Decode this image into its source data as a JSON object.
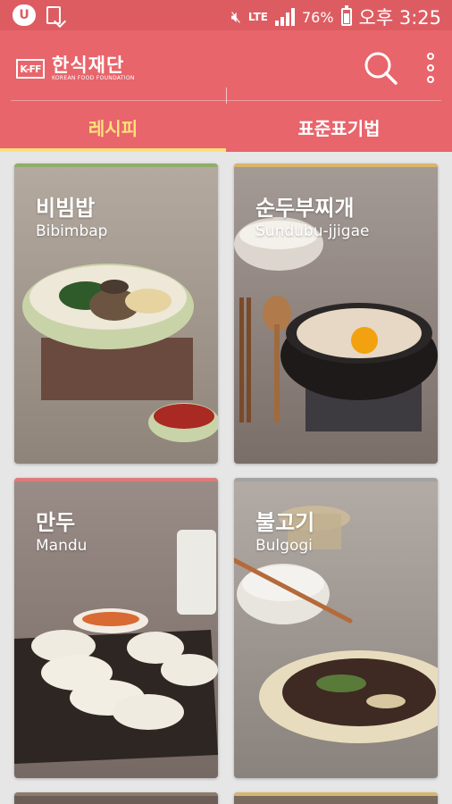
{
  "status_bar": {
    "battery_percent": "76%",
    "time": "오후 3:25",
    "network": "LTE",
    "icons": [
      "u-plus-icon",
      "download-icon",
      "mute-icon",
      "signal-icon",
      "battery-icon"
    ]
  },
  "header": {
    "logo_mark": "K-FF",
    "logo_korean": "한식재단",
    "logo_english": "KOREAN FOOD FOUNDATION",
    "icons": [
      "search-icon",
      "more-vert-icon"
    ]
  },
  "tabs": [
    {
      "label": "레시피",
      "active": true
    },
    {
      "label": "표준표기법",
      "active": false
    }
  ],
  "colors": {
    "brand": "#e8656b",
    "status_bar": "#dd5c62",
    "active_tab": "#ffe07a",
    "background": "#e6e6e6"
  },
  "recipes": [
    {
      "korean": "비빔밥",
      "english": "Bibimbap",
      "stripe": "#8fae6a"
    },
    {
      "korean": "순두부찌개",
      "english": "Sundubu-jjigae",
      "stripe": "#d8b66a"
    },
    {
      "korean": "만두",
      "english": "Mandu",
      "stripe": "#e07a7a"
    },
    {
      "korean": "불고기",
      "english": "Bulgogi",
      "stripe": "#a3a3a3"
    },
    {
      "korean": "",
      "english": "",
      "stripe": "#8d7b6a"
    },
    {
      "korean": "",
      "english": "",
      "stripe": "#d8b66a"
    }
  ]
}
